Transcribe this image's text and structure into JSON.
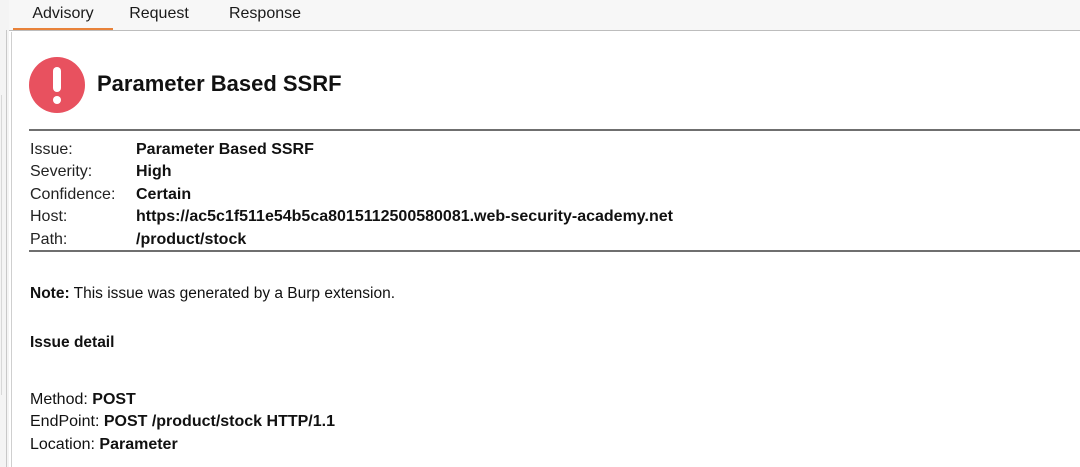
{
  "tabs": {
    "advisory": "Advisory",
    "request": "Request",
    "response": "Response"
  },
  "issue_title": "Parameter Based SSRF",
  "properties": {
    "issue_label": "Issue:",
    "issue_value": "Parameter Based SSRF",
    "severity_label": "Severity:",
    "severity_value": "High",
    "confidence_label": "Confidence:",
    "confidence_value": "Certain",
    "host_label": "Host:",
    "host_value": "https://ac5c1f511e54b5ca8015112500580081.web-security-academy.net",
    "path_label": "Path:",
    "path_value": "/product/stock"
  },
  "note": {
    "label": "Note:",
    "text": " This issue was generated by a Burp extension."
  },
  "issue_detail": {
    "heading": "Issue detail",
    "method_label": "Method: ",
    "method_value": "POST",
    "endpoint_label": "EndPoint: ",
    "endpoint_value": "POST /product/stock HTTP/1.1",
    "location_label": "Location: ",
    "location_value": "Parameter"
  },
  "colors": {
    "alert": "#e8515f",
    "active_tab_underline": "#e8823a"
  },
  "icons": {
    "alert": "exclamation-circle-icon"
  }
}
